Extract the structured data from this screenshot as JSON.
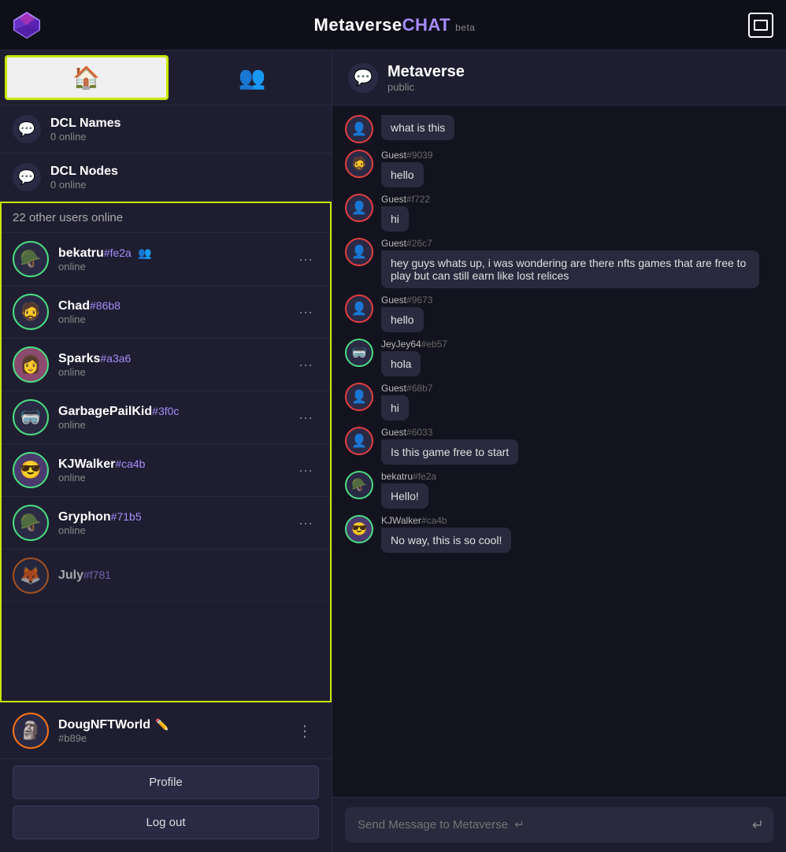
{
  "header": {
    "title_metaverse": "Metaverse",
    "title_chat": "CHAT",
    "title_beta": "beta",
    "window_button_label": "□"
  },
  "tabs": [
    {
      "id": "home",
      "label": "🏠",
      "active": true
    },
    {
      "id": "users",
      "label": "👥",
      "active": false
    }
  ],
  "channels": [
    {
      "name": "DCL Names",
      "status": "0 online"
    },
    {
      "name": "DCL Nodes",
      "status": "0 online"
    }
  ],
  "online_section": {
    "header": "22 other users online",
    "users": [
      {
        "name": "bekatru",
        "hash": "#fe2a",
        "status": "online",
        "avatar": "🪖",
        "friend": true
      },
      {
        "name": "Chad",
        "hash": "#86b8",
        "status": "online",
        "avatar": "🧔"
      },
      {
        "name": "Sparks",
        "hash": "#a3a6",
        "status": "online",
        "avatar": "👩"
      },
      {
        "name": "GarbagePailKid",
        "hash": "#3f0c",
        "status": "online",
        "avatar": "🥽"
      },
      {
        "name": "KJWalker",
        "hash": "#ca4b",
        "status": "online",
        "avatar": "😎"
      },
      {
        "name": "Gryphon",
        "hash": "#71b5",
        "status": "online",
        "avatar": "🪖"
      }
    ],
    "partial_user": {
      "name": "July",
      "hash": "#f781",
      "avatar": "🦊"
    }
  },
  "current_user": {
    "name": "DougNFTWorld",
    "hash": "#b89e",
    "avatar": "🗿"
  },
  "bottom_buttons": {
    "profile": "Profile",
    "logout": "Log out"
  },
  "chat": {
    "room_name": "Metaverse",
    "room_type": "public",
    "messages": [
      {
        "sender": "Guest",
        "hash": "#9039",
        "text": "hello",
        "avatar": "🧔",
        "border": "red"
      },
      {
        "sender": "Guest",
        "hash": "#f722",
        "text": "hi",
        "avatar": "👤",
        "border": "red"
      },
      {
        "sender": "Guest",
        "hash": "#26c7",
        "text": "hey guys whats up, i was wondering are there nfts games that are free to play but can still earn like lost relices",
        "avatar": "👤",
        "border": "red"
      },
      {
        "sender": "Guest",
        "hash": "#9673",
        "text": "hello",
        "avatar": "👤",
        "border": "red"
      },
      {
        "sender": "JeyJey64",
        "hash": "#eb57",
        "text": "hola",
        "avatar": "🥽",
        "border": "green"
      },
      {
        "sender": "Guest",
        "hash": "#68b7",
        "text": "hi",
        "avatar": "👤",
        "border": "red"
      },
      {
        "sender": "Guest",
        "hash": "#6033",
        "text": "Is this game free to start",
        "avatar": "👤",
        "border": "red"
      },
      {
        "sender": "bekatru",
        "hash": "#fe2a",
        "text": "Hello!",
        "avatar": "🪖",
        "border": "green"
      },
      {
        "sender": "KJWalker",
        "hash": "#ca4b",
        "text": "No way, this is so cool!",
        "avatar": "😎",
        "border": "green"
      }
    ],
    "input_placeholder": "Send Message to Metaverse  ↵"
  }
}
